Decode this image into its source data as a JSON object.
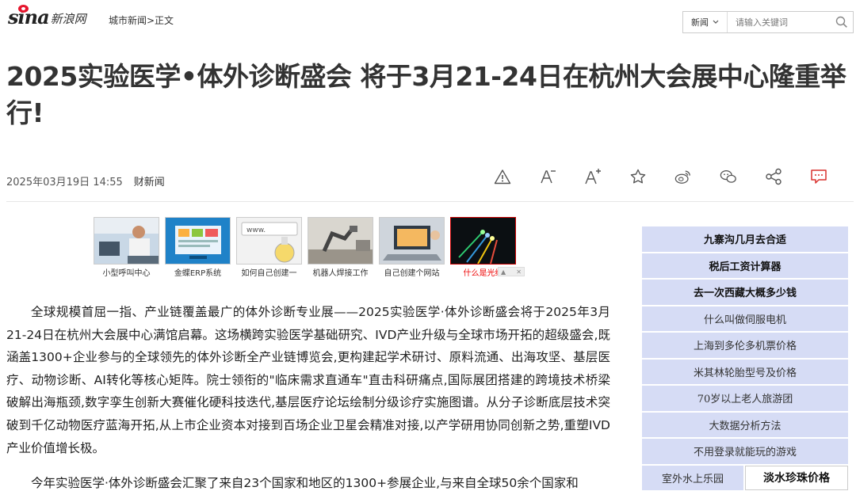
{
  "header": {
    "logo_mark": "sina",
    "logo_text": "新浪网",
    "breadcrumb": "城市新闻>正文",
    "search_select": "新闻",
    "search_placeholder": "请输入关键词"
  },
  "article": {
    "title": "2025实验医学•体外诊断盛会 将于3月21-24日在杭州大会展中心隆重举行!",
    "datetime": "2025年03月19日 14:55",
    "source": "财新闻",
    "paragraphs": [
      "全球规模首屈一指、产业链覆盖最广的体外诊断专业展——2025实验医学·体外诊断盛会将于2025年3月21-24日在杭州大会展中心满馆启幕。这场横跨实验医学基础研究、IVD产业升级与全球市场开拓的超级盛会,既涵盖1300+企业参与的全球领先的体外诊断全产业链博览会,更构建起学术研讨、原料流通、出海攻坚、基层医疗、动物诊断、AI转化等核心矩阵。院士领衔的\"临床需求直通车\"直击科研痛点,国际展团搭建的跨境技术桥梁破解出海瓶颈,数字孪生创新大赛催化硬科技迭代,基层医疗论坛绘制分级诊疗实施图谱。从分子诊断底层技术突破到千亿动物医疗蓝海开拓,从上市企业资本对接到百场企业卫星会精准对接,以产学研用协同创新之势,重塑IVD产业价值增长极。",
      "今年实验医学·体外诊断盛会汇聚了来自23个国家和地区的1300+参展企业,与来自全球50余个国家和"
    ]
  },
  "toolbar": {
    "icons": [
      "warning-icon",
      "font-decrease-icon",
      "font-increase-icon",
      "favorite-star-icon",
      "weibo-icon",
      "wechat-icon",
      "share-icon",
      "comment-icon"
    ],
    "comment_color": "#d9312d"
  },
  "thumbnails": [
    {
      "caption": "小型呼叫中心",
      "icon": "call-center-icon"
    },
    {
      "caption": "金蝶ERP系统",
      "icon": "erp-icon"
    },
    {
      "caption": "如何自己创建一",
      "icon": "www-icon"
    },
    {
      "caption": "机器人焊接工作",
      "icon": "robot-arm-icon"
    },
    {
      "caption": "自己创建个网站",
      "icon": "laptop-icon"
    },
    {
      "caption": "什么是光缆",
      "icon": "fiber-optic-icon"
    }
  ],
  "sidebar": {
    "items": [
      {
        "label": "九寨沟几月去合适"
      },
      {
        "label": "税后工资计算器"
      },
      {
        "label": "去一次西藏大概多少钱"
      },
      {
        "label": "什么叫做伺服电机"
      },
      {
        "label": "上海到多伦多机票价格"
      },
      {
        "label": "米其林轮胎型号及价格"
      },
      {
        "label": "70岁以上老人旅游团"
      },
      {
        "label": "大数据分析方法"
      },
      {
        "label": "不用登录就能玩的游戏"
      }
    ],
    "row": [
      {
        "label": "室外水上乐园"
      },
      {
        "label": "淡水珍珠价格"
      }
    ],
    "bg_color": "#d6dcf5"
  }
}
